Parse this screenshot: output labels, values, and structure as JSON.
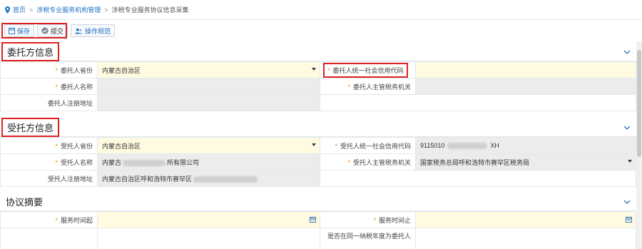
{
  "breadcrumb": {
    "home": "首页",
    "level1": "涉税专业服务机构管理",
    "level2": "涉税专业服务协议信息采集"
  },
  "toolbar": {
    "save_label": "保存",
    "submit_label": "提交",
    "guide_label": "操作规范"
  },
  "client_section": {
    "title": "委托方信息",
    "province_label": "委托人省份",
    "province_value": "内蒙古自治区",
    "credit_code_label": "委托人统一社会信用代码",
    "credit_code_value": "",
    "name_label": "委托人名称",
    "name_value": "",
    "tax_authority_label": "委托人主管税务机关",
    "tax_authority_value": "",
    "address_label": "委托人注册地址",
    "address_value": ""
  },
  "agent_section": {
    "title": "受托方信息",
    "province_label": "受托人省份",
    "province_value": "内蒙古自治区",
    "credit_code_label": "受托人统一社会信用代码",
    "credit_code_prefix": "9115010",
    "credit_code_suffix": "XH",
    "name_label": "受托人名称",
    "name_prefix": "内蒙古",
    "name_suffix": "所有限公司",
    "tax_authority_label": "受托人主管税务机关",
    "tax_authority_value": "国家税务总局呼和浩特市赛罕区税务局",
    "address_label": "受托人注册地址",
    "address_prefix": "内蒙古自治区呼和浩特市赛罕区"
  },
  "summary_section": {
    "title": "协议摘要",
    "start_label": "服务时间起",
    "end_label": "服务时间止",
    "cut_label": "是否在同一纳税年度为委托人"
  },
  "colors": {
    "accent": "#1f6fc4",
    "highlight": "#e02020",
    "required": "#f08a1c",
    "editable_bg": "#fffbe0",
    "readonly_bg": "#ececec"
  }
}
